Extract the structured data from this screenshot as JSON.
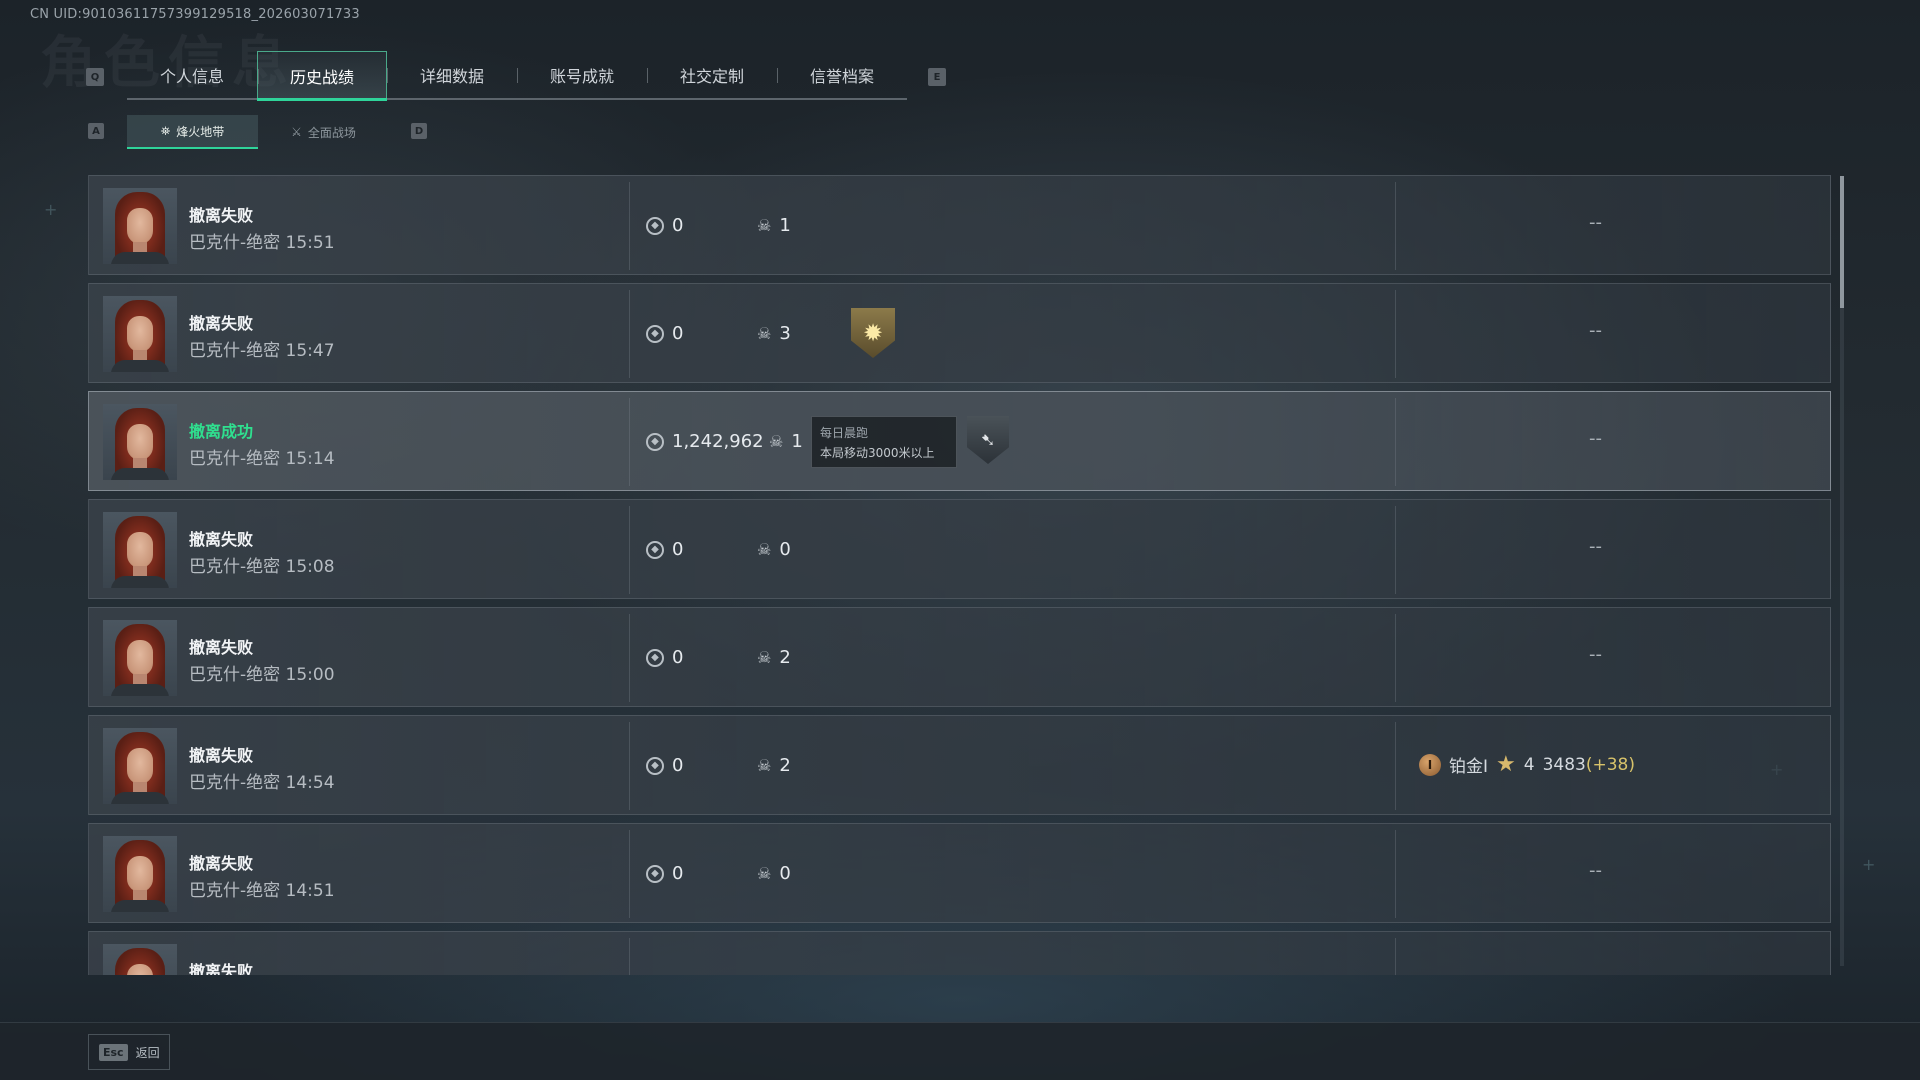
{
  "header": {
    "uid": "CN UID:9010361175739912951​8_202603071733",
    "bg_title": "角色信息"
  },
  "keyhints": {
    "left_tab": "Q",
    "right_tab": "E",
    "left_sub": "A",
    "right_sub": "D"
  },
  "tabs": [
    {
      "label": "个人信息"
    },
    {
      "label": "历史战绩",
      "active": true
    },
    {
      "label": "详细数据"
    },
    {
      "label": "账号成就"
    },
    {
      "label": "社交定制"
    },
    {
      "label": "信誉档案"
    }
  ],
  "subtabs": [
    {
      "label": "烽火地带",
      "icon": "zone-icon",
      "active": true
    },
    {
      "label": "全面战场",
      "icon": "battlefield-icon"
    }
  ],
  "matches": [
    {
      "result": "撤离失败",
      "map": "巴克什-绝密 15:51",
      "value": "0",
      "kills": "1",
      "right": "--"
    },
    {
      "result": "撤离失败",
      "map": "巴克什-绝密 15:47",
      "value": "0",
      "kills": "3",
      "right": "--",
      "badge": "sun-emblem"
    },
    {
      "result": "撤离成功",
      "success": true,
      "map": "巴克什-绝密 15:14",
      "value": "1,242,962",
      "kills": "1",
      "right": "--",
      "tooltip": {
        "title": "每日晨跑",
        "desc": "本局移动3000米以上"
      },
      "badge": "run-emblem"
    },
    {
      "result": "撤离失败",
      "map": "巴克什-绝密 15:08",
      "value": "0",
      "kills": "0",
      "right": "--"
    },
    {
      "result": "撤离失败",
      "map": "巴克什-绝密 15:00",
      "value": "0",
      "kills": "2",
      "right": "--"
    },
    {
      "result": "撤离失败",
      "map": "巴克什-绝密 14:54",
      "value": "0",
      "kills": "2",
      "rank": {
        "tier": "铂金I",
        "stars": "4",
        "score": "3483",
        "gain": "(+38)"
      }
    },
    {
      "result": "撤离失败",
      "map": "巴克什-绝密 14:51",
      "value": "0",
      "kills": "0",
      "right": "--"
    },
    {
      "result": "撤离失败",
      "map": "",
      "value": "",
      "kills": "",
      "right": ""
    }
  ],
  "footer": {
    "esc_key": "Esc",
    "back_label": "返回"
  },
  "colors": {
    "accent": "#2fd49a",
    "success": "#2fe08f",
    "gain": "#d7c26a"
  }
}
